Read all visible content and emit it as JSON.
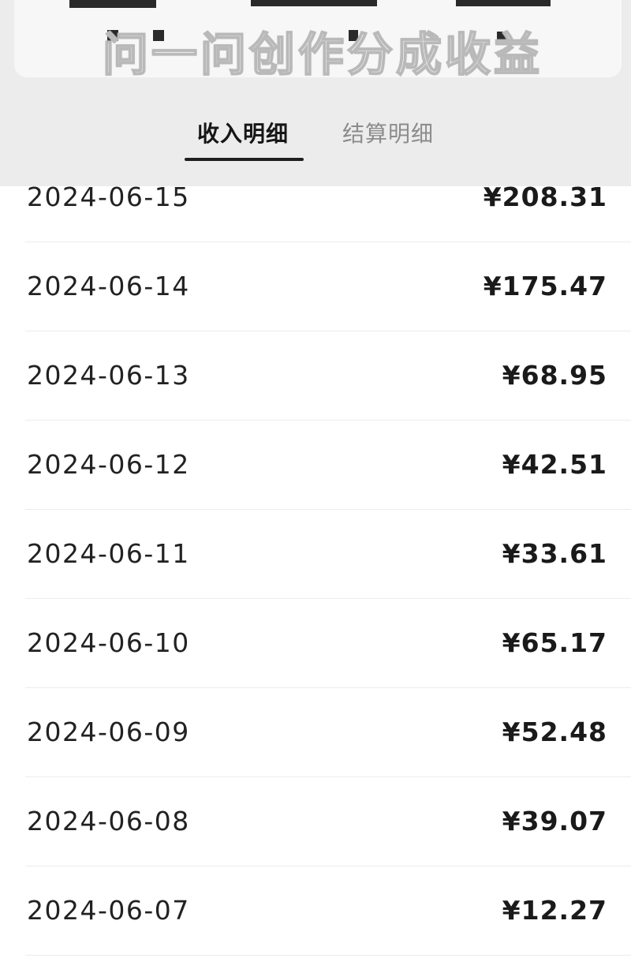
{
  "banner": {
    "title": "问一问创作分成收益"
  },
  "tabs": [
    {
      "label": "收入明细",
      "active": true
    },
    {
      "label": "结算明细",
      "active": false
    }
  ],
  "income_rows": [
    {
      "date": "2024-06-15",
      "amount": "¥208.31"
    },
    {
      "date": "2024-06-14",
      "amount": "¥175.47"
    },
    {
      "date": "2024-06-13",
      "amount": "¥68.95"
    },
    {
      "date": "2024-06-12",
      "amount": "¥42.51"
    },
    {
      "date": "2024-06-11",
      "amount": "¥33.61"
    },
    {
      "date": "2024-06-10",
      "amount": "¥65.17"
    },
    {
      "date": "2024-06-09",
      "amount": "¥52.48"
    },
    {
      "date": "2024-06-08",
      "amount": "¥39.07"
    },
    {
      "date": "2024-06-07",
      "amount": "¥12.27"
    }
  ],
  "colors": {
    "header_bg": "#ececec",
    "active_tab": "#161616",
    "inactive_tab": "#8c8c8c",
    "divider": "#ececec"
  }
}
